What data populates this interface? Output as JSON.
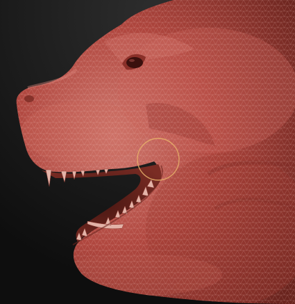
{
  "viewport": {
    "background_top": "#2e2e2e",
    "background_bottom": "#0e0e0e",
    "clay_color": "#b0473f",
    "clay_highlight": "#d07a70",
    "clay_shadow": "#5a1f1a",
    "wire_color": "#f4c9c2",
    "tooth_color": "#e3b3a8",
    "brush_cursor_color": "#e8b26a",
    "brush_cursor": "circle-brush-cursor-icon"
  }
}
